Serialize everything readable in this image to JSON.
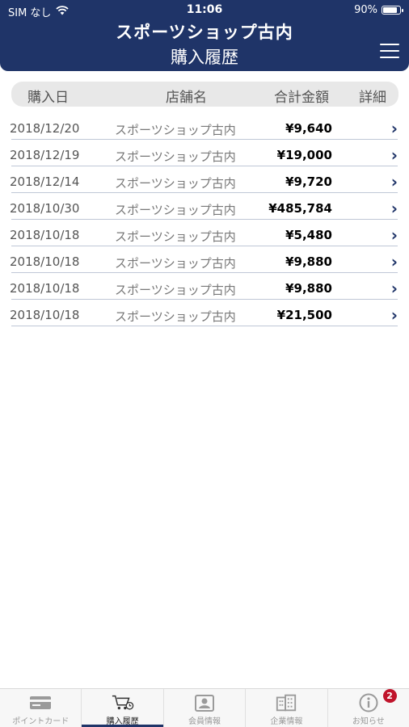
{
  "status_bar": {
    "carrier": "SIM なし",
    "time": "11:06",
    "battery": "90%",
    "battery_level": 0.9
  },
  "header": {
    "app_title": "スポーツショップ古内",
    "page_title": "購入履歴",
    "menu_icon": "hamburger-menu-icon"
  },
  "table": {
    "headers": {
      "date": "購入日",
      "store": "店舗名",
      "total": "合計金額",
      "detail": "詳細"
    },
    "rows": [
      {
        "date": "2018/12/20",
        "store": "スポーツショップ古内",
        "amount": "¥9,640"
      },
      {
        "date": "2018/12/19",
        "store": "スポーツショップ古内",
        "amount": "¥19,000"
      },
      {
        "date": "2018/12/14",
        "store": "スポーツショップ古内",
        "amount": "¥9,720"
      },
      {
        "date": "2018/10/30",
        "store": "スポーツショップ古内",
        "amount": "¥485,784"
      },
      {
        "date": "2018/10/18",
        "store": "スポーツショップ古内",
        "amount": "¥5,480"
      },
      {
        "date": "2018/10/18",
        "store": "スポーツショップ古内",
        "amount": "¥9,880"
      },
      {
        "date": "2018/10/18",
        "store": "スポーツショップ古内",
        "amount": "¥9,880"
      },
      {
        "date": "2018/10/18",
        "store": "スポーツショップ古内",
        "amount": "¥21,500"
      }
    ],
    "chevron": "›"
  },
  "tabbar": {
    "tabs": [
      {
        "label": "ポイントカード",
        "icon": "point-card-icon",
        "active": false
      },
      {
        "label": "購入履歴",
        "icon": "cart-history-icon",
        "active": true
      },
      {
        "label": "会員情報",
        "icon": "member-id-icon",
        "active": false
      },
      {
        "label": "企業情報",
        "icon": "building-icon",
        "active": false
      },
      {
        "label": "お知らせ",
        "icon": "info-icon",
        "active": false,
        "badge": "2"
      }
    ]
  },
  "colors": {
    "primary": "#1f3468",
    "badge": "#c0142b",
    "header_row_bg": "#e8e8e8"
  }
}
